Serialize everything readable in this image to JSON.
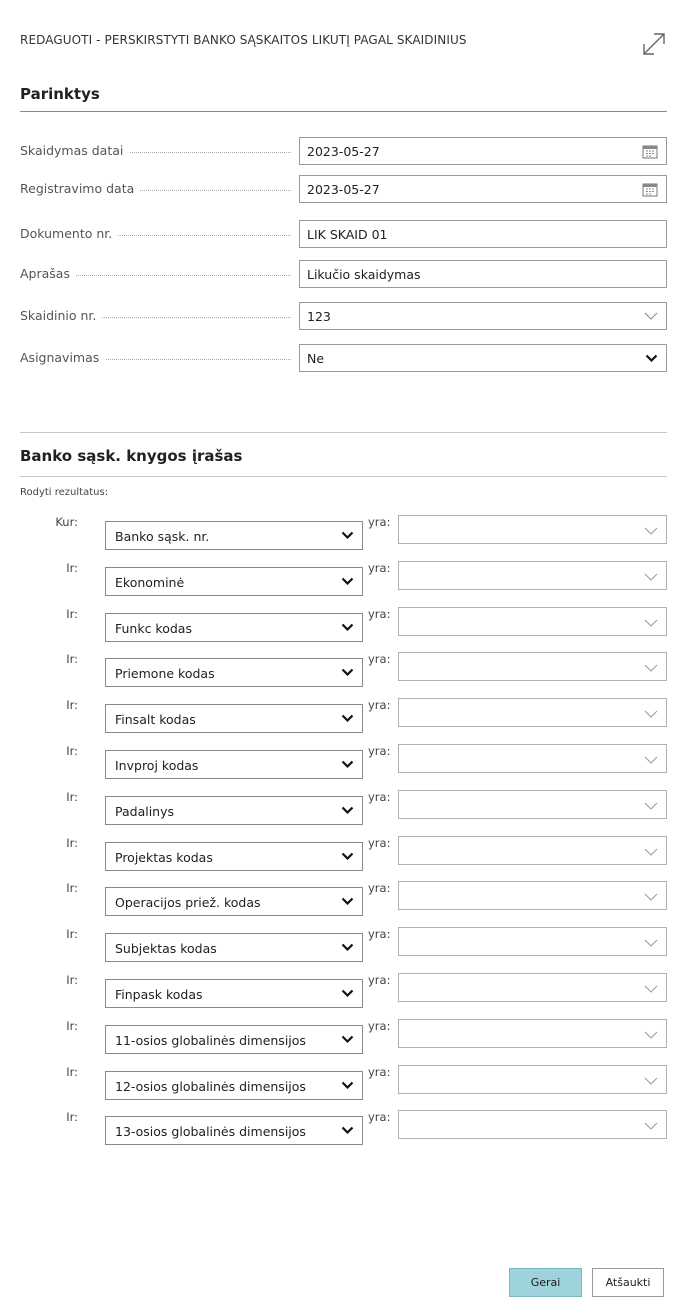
{
  "dialog": {
    "title": "REDAGUOTI - PERSKIRSTYTI BANKO SĄSKAITOS LIKUTĮ PAGAL SKAIDINIUS"
  },
  "options": {
    "heading": "Parinktys",
    "fields": [
      {
        "label": "Skaidymas datai",
        "value": "2023-05-27",
        "icon": "calendar-icon"
      },
      {
        "label": "Registravimo data",
        "value": "2023-05-27",
        "icon": "calendar-icon"
      },
      {
        "label": "Dokumento nr.",
        "value": "LIK SKAID 01"
      },
      {
        "label": "Aprašas",
        "value": "Likučio skaidymas"
      },
      {
        "label": "Skaidinio nr.",
        "value": "123",
        "icon": "chevron-down-light-icon"
      },
      {
        "label": "Asignavimas",
        "value": "Ne",
        "icon": "chevron-down-bold-icon"
      }
    ]
  },
  "filters": {
    "heading": "Banko sąsk. knygos įrašas",
    "show_results_label": "Rodyti rezultatus:",
    "is_label": "yra:",
    "rows": [
      {
        "connector": "Kur:",
        "field": "Banko sąsk. nr.",
        "value": ""
      },
      {
        "connector": "Ir:",
        "field": "Ekonominė",
        "value": ""
      },
      {
        "connector": "Ir:",
        "field": "Funkc kodas",
        "value": ""
      },
      {
        "connector": "Ir:",
        "field": "Priemone kodas",
        "value": ""
      },
      {
        "connector": "Ir:",
        "field": "Finsalt kodas",
        "value": ""
      },
      {
        "connector": "Ir:",
        "field": "Invproj kodas",
        "value": ""
      },
      {
        "connector": "Ir:",
        "field": "Padalinys",
        "value": ""
      },
      {
        "connector": "Ir:",
        "field": "Projektas kodas",
        "value": ""
      },
      {
        "connector": "Ir:",
        "field": "Operacijos priež. kodas",
        "value": ""
      },
      {
        "connector": "Ir:",
        "field": "Subjektas kodas",
        "value": ""
      },
      {
        "connector": "Ir:",
        "field": "Finpask kodas",
        "value": ""
      },
      {
        "connector": "Ir:",
        "field": "11-osios globalinės dimensijos",
        "value": ""
      },
      {
        "connector": "Ir:",
        "field": "12-osios globalinės dimensijos",
        "value": ""
      },
      {
        "connector": "Ir:",
        "field": "13-osios globalinės dimensijos",
        "value": ""
      }
    ]
  },
  "actions": {
    "ok_label": "Gerai",
    "cancel_label": "Atšaukti"
  },
  "colors": {
    "ok_button": "#9fd3dc",
    "border": "#9a9a9a"
  }
}
